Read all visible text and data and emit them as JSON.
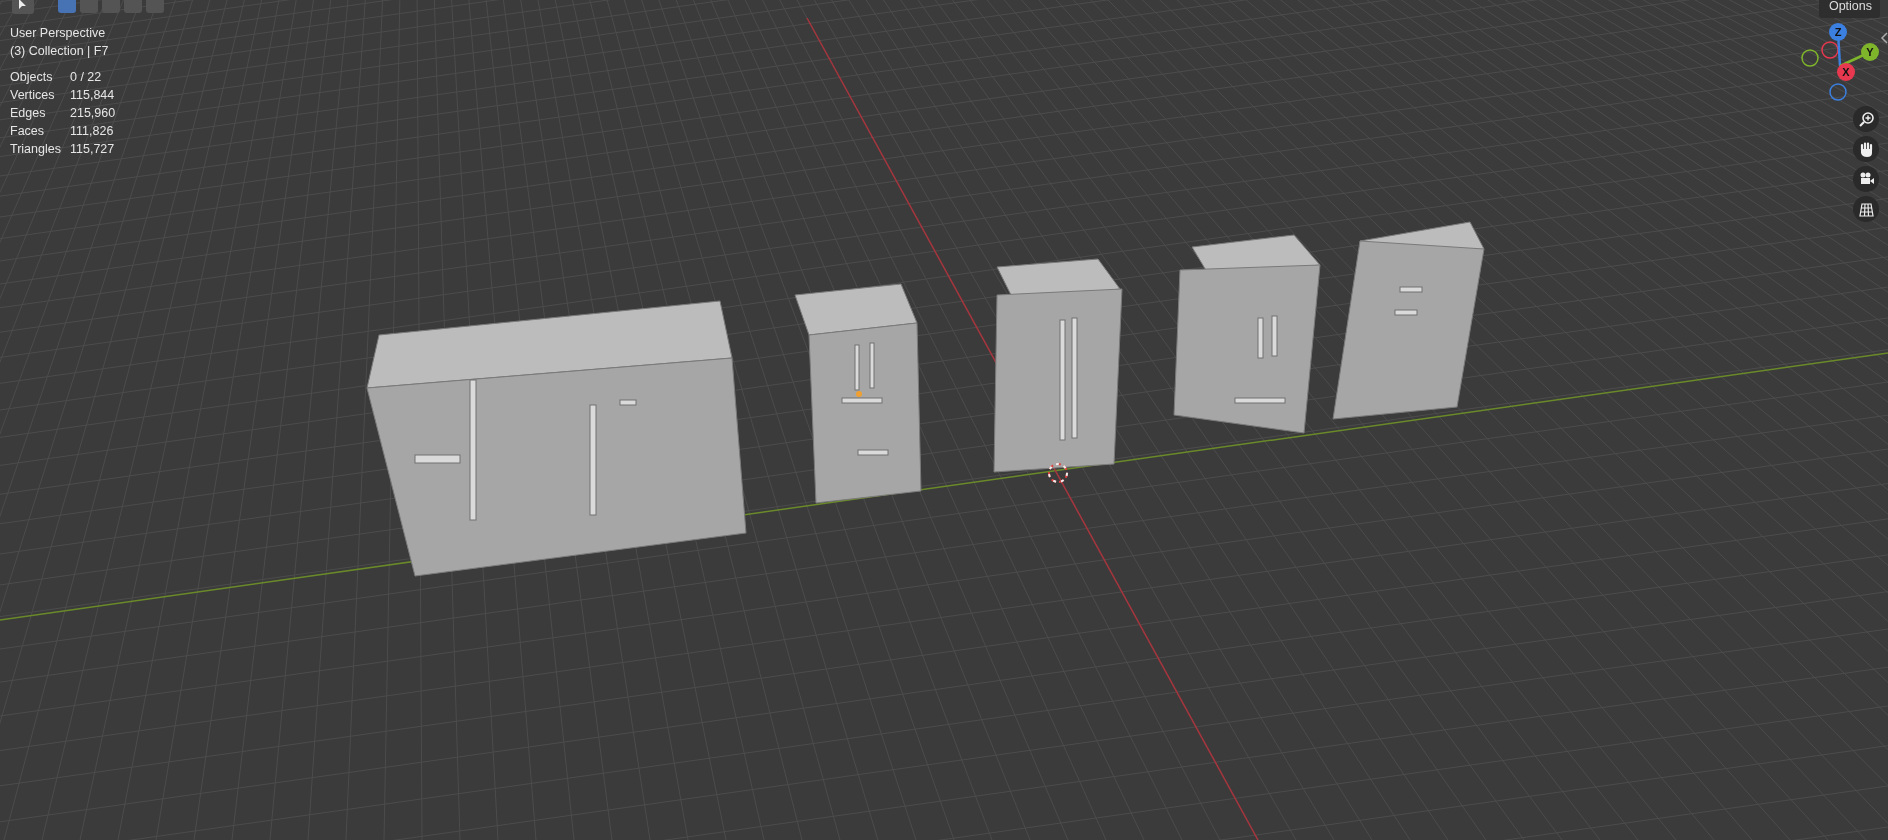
{
  "toolbar": {
    "mode_buttons": [
      {
        "selected": true
      },
      {
        "selected": false
      },
      {
        "selected": false
      },
      {
        "selected": false
      },
      {
        "selected": false
      }
    ]
  },
  "header": {
    "options": "Options"
  },
  "overlay": {
    "view_name": "User Perspective",
    "collection": "(3) Collection | F7",
    "stats": [
      {
        "label": "Objects",
        "value": "0 / 22"
      },
      {
        "label": "Vertices",
        "value": "115,844"
      },
      {
        "label": "Edges",
        "value": "215,960"
      },
      {
        "label": "Faces",
        "value": "111,826"
      },
      {
        "label": "Triangles",
        "value": "115,727"
      }
    ]
  },
  "gizmo": {
    "axes": [
      {
        "kind": "z",
        "label": "Z",
        "color": "#3b7fe0"
      },
      {
        "kind": "y",
        "label": "Y",
        "color": "#7fb52b"
      },
      {
        "kind": "x",
        "label": "X",
        "color": "#e8384f"
      }
    ]
  }
}
